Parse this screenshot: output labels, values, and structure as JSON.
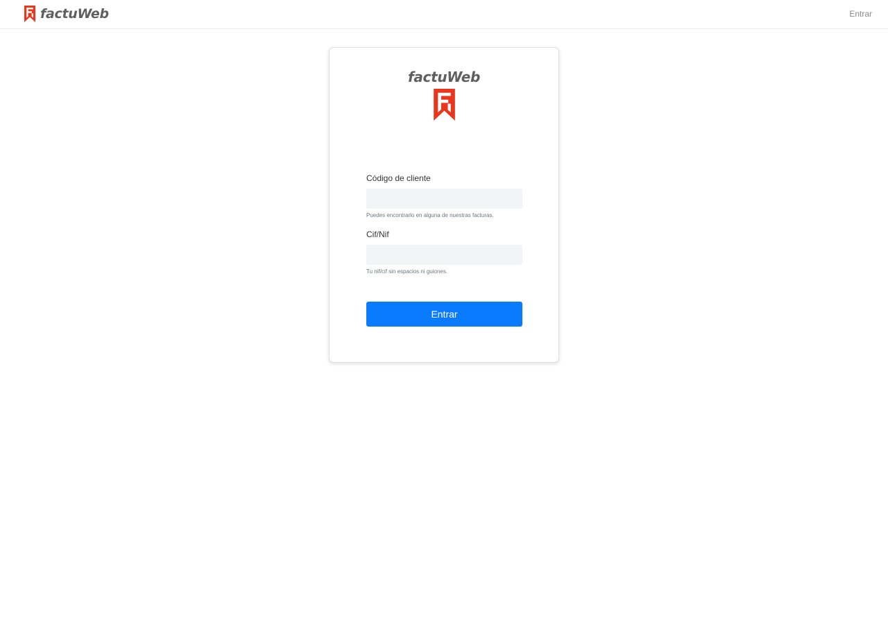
{
  "navbar": {
    "brand": "factuWeb",
    "login_link": "Entrar"
  },
  "card": {
    "logo_text": "factuWeb",
    "form": {
      "client_code": {
        "label": "Código de cliente",
        "value": "",
        "help": "Puedes encontrarlo en alguna de nuestras facturas."
      },
      "cif_nif": {
        "label": "Cif/Nif",
        "value": "",
        "help": "Tu nif/cif sin espacios ni guiones."
      },
      "submit_label": "Entrar"
    }
  },
  "colors": {
    "brand_red": "#e8371c",
    "primary_blue": "#0a7bff",
    "brand_text_gray": "#5f5f5f"
  },
  "icons": {
    "brand_logo": "factuweb-logo-icon"
  }
}
